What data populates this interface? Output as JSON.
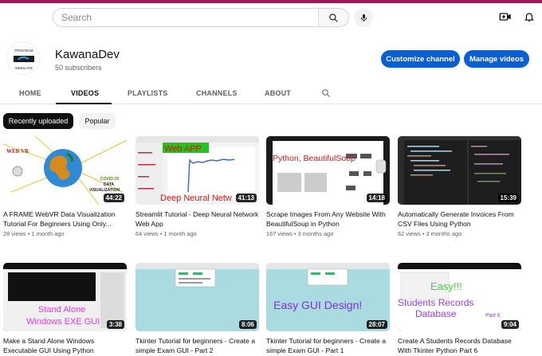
{
  "topbar": {
    "search_placeholder": "Search"
  },
  "channel": {
    "name": "KawanaDev",
    "subscribers": "50 subscribers",
    "customize_label": "Customize channel",
    "manage_label": "Manage videos",
    "avatar_text_top": "PROGRAM",
    "avatar_text_bottom": "SIMULATE"
  },
  "tabs": [
    {
      "label": "HOME"
    },
    {
      "label": "VIDEOS"
    },
    {
      "label": "PLAYLISTS"
    },
    {
      "label": "CHANNELS"
    },
    {
      "label": "ABOUT"
    }
  ],
  "chips": [
    {
      "label": "Recently uploaded"
    },
    {
      "label": "Popular"
    }
  ],
  "videos": [
    {
      "title": "A FRAME WebVR Data Visualization Tutorial For Beginners Using Only...",
      "views": "28 views",
      "age": "1 month ago",
      "duration": "44:22",
      "thumb_text": [
        "WEB VR",
        "COVID-19",
        "DATA",
        "VISUALIZATION"
      ]
    },
    {
      "title": "Streamlit Tutorial - Deep Neural Network Web App",
      "views": "64 views",
      "age": "1 month ago",
      "duration": "41:13",
      "thumb_text": [
        "Web APP",
        "Deep Neural Netw"
      ]
    },
    {
      "title": "Scrape Images From Any Website With BeautifulSoup in Python",
      "views": "167 views",
      "age": "3 months ago",
      "duration": "14:18",
      "thumb_text": [
        "Python,  BeautifulSoup"
      ]
    },
    {
      "title": "Automatically Generate Invoices From CSV Files Using Python",
      "views": "62 views",
      "age": "3 months ago",
      "duration": "15:39",
      "thumb_text": []
    },
    {
      "title": "Make a Stand Alone Windows Executable GUI Using Python",
      "views": "",
      "age": "",
      "duration": "3:38",
      "thumb_text": [
        "Stand Alone",
        "Windows EXE GUI"
      ]
    },
    {
      "title": "Tkinter Tutorial for beginners - Create a simple Exam GUI - Part 2",
      "views": "",
      "age": "",
      "duration": "8:06",
      "thumb_text": []
    },
    {
      "title": "Tkinter Tutorial for beginners - Create a simple Exam GUI - Part 1",
      "views": "",
      "age": "",
      "duration": "28:07",
      "thumb_text": [
        "Easy GUI Design!"
      ]
    },
    {
      "title": "Create A Students Records Database With Tkinter Python Part 6",
      "views": "",
      "age": "",
      "duration": "9:04",
      "thumb_text": [
        "Easy!!!",
        "Students Records",
        "Database",
        "Part 6"
      ]
    }
  ],
  "colors": {
    "brand_bar": "#a3145a",
    "button_blue": "#065fd4"
  }
}
